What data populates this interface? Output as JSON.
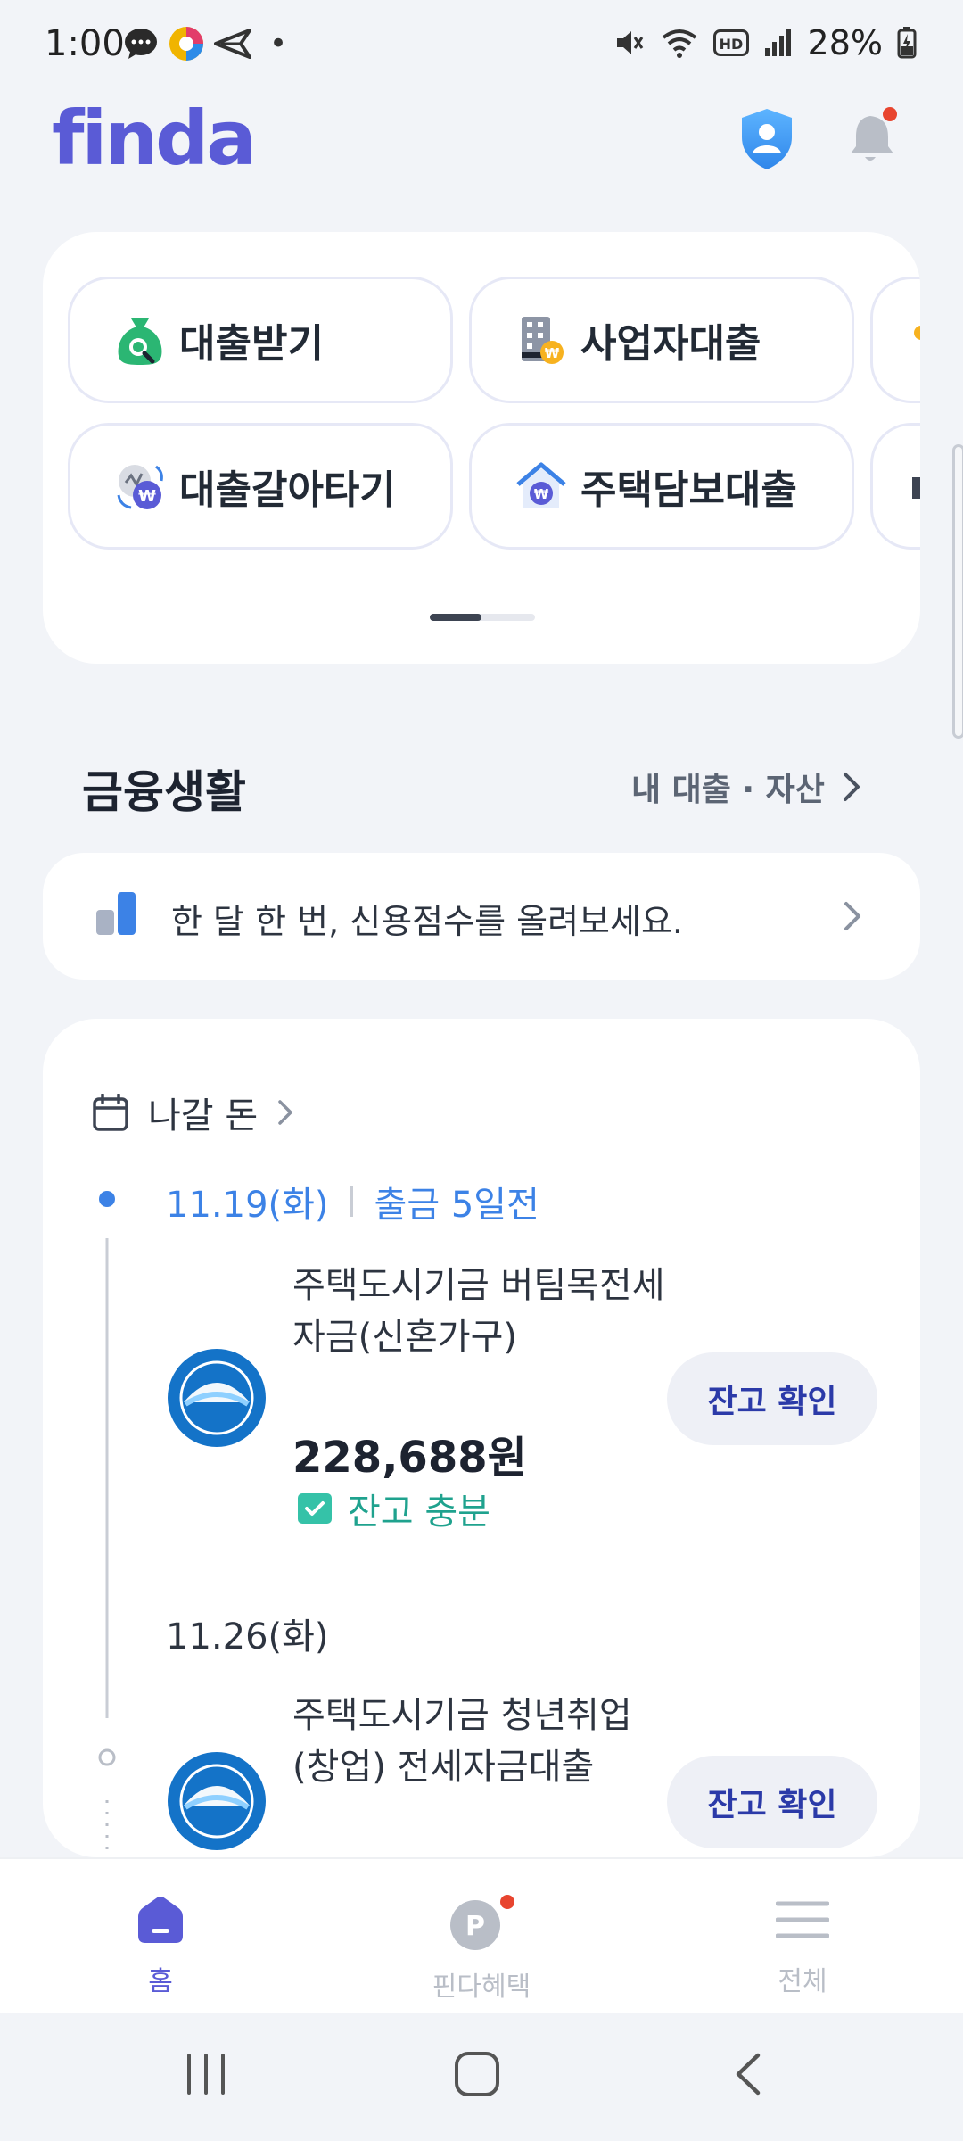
{
  "status_bar": {
    "time": "1:00",
    "battery": "28%",
    "dot": "•"
  },
  "header": {
    "logo": "finda"
  },
  "quick_menu": {
    "items": [
      {
        "label": "대출받기",
        "icon": "money-bag-icon"
      },
      {
        "label": "사업자대출",
        "icon": "building-coin-icon"
      },
      {
        "label": "대출갈아타기",
        "icon": "refinance-icon"
      },
      {
        "label": "주택담보대출",
        "icon": "house-coin-icon"
      }
    ]
  },
  "finance_section": {
    "title": "금융생활",
    "link_label": "내 대출 · 자산",
    "banner_text": "한 달 한 번, 신용점수를 올려보세요."
  },
  "bills": {
    "header": "나갈 돈",
    "groups": [
      {
        "date": "11.19(화)",
        "due": "출금 5일전",
        "name": "주택도시기금 버팀목전세자금(신혼가구)",
        "amount": "228,688원",
        "status": "잔고 충분",
        "button": "잔고 확인"
      },
      {
        "date": "11.26(화)",
        "name": "주택도시기금 청년취업(창업) 전세자금대출",
        "button": "잔고 확인"
      }
    ]
  },
  "bottom_nav": {
    "items": [
      {
        "label": "홈"
      },
      {
        "label": "핀다혜택"
      },
      {
        "label": "전체"
      }
    ]
  },
  "colors": {
    "brand": "#5a5bd6",
    "accent_blue": "#3c82e6",
    "success": "#1fa28e",
    "notification_dot": "#e8452f"
  }
}
